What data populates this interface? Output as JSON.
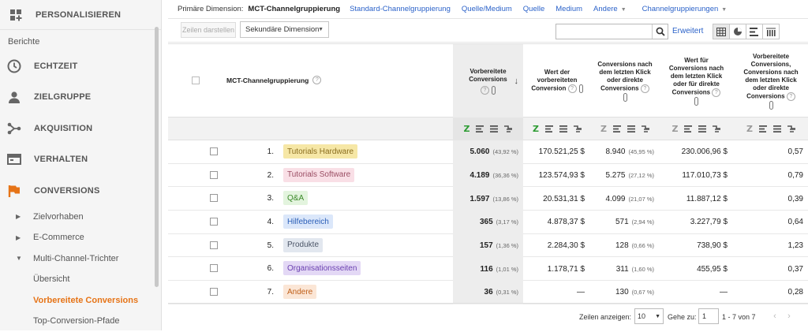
{
  "sidebar": {
    "personalize": "PERSONALISIEREN",
    "section": "Berichte",
    "items": [
      {
        "label": "ECHTZEIT",
        "icon": "clock-icon"
      },
      {
        "label": "ZIELGRUPPE",
        "icon": "person-icon"
      },
      {
        "label": "AKQUISITION",
        "icon": "acquisition-icon"
      },
      {
        "label": "VERHALTEN",
        "icon": "behavior-icon"
      },
      {
        "label": "CONVERSIONS",
        "icon": "flag-icon",
        "color": "#e67417"
      }
    ],
    "sub": [
      "Zielvorhaben",
      "E-Commerce",
      "Multi-Channel-Trichter"
    ],
    "sub2": [
      "Übersicht",
      "Vorbereitete Conversions",
      "Top-Conversion-Pfade"
    ],
    "active": "Vorbereitete Conversions",
    "active_color": "#e67417"
  },
  "dimension": {
    "primary_label": "Primäre Dimension:",
    "current": "MCT-Channelgruppierung",
    "links": [
      "Standard-Channelgruppierung",
      "Quelle/Medium",
      "Quelle",
      "Medium"
    ],
    "other": "Andere",
    "groupings": "Channelgruppierungen",
    "link_color": "#2b62c9"
  },
  "toolbar": {
    "show_rows_btn": "Zeilen darstellen",
    "secondary": "Sekundäre Dimension",
    "search_value": "",
    "advanced": "Erweitert"
  },
  "table": {
    "dim_header": "MCT-Channelgruppierung",
    "columns": [
      {
        "l1": "Vorbereitete",
        "l2": "Conversions"
      },
      {
        "l1": "Wert der",
        "l2": "vorbereiteten",
        "l3": "Conversion"
      },
      {
        "l1": "Conversions nach",
        "l2": "dem letzten Klick",
        "l3": "oder direkte",
        "l4": "Conversions"
      },
      {
        "l1": "Wert für",
        "l2": "Conversions nach",
        "l3": "dem letzten Klick",
        "l4": "oder für direkte",
        "l5": "Conversions"
      },
      {
        "l1": "Vorbereitete",
        "l2": "Conversions,",
        "l3": "Conversions nach",
        "l4": "dem letzten Klick",
        "l5": "oder direkte",
        "l6": "Conversions"
      }
    ],
    "rows": [
      {
        "n": "1.",
        "name": "Tutorials Hardware",
        "bg": "#f6e7a6",
        "fg": "#8a6d1e",
        "ac": "5.060",
        "acp": "(43,92 %)",
        "av": "170.521,25 $",
        "lc": "8.940",
        "lcp": "(45,95 %)",
        "lv": "230.006,96 $",
        "ratio": "0,57"
      },
      {
        "n": "2.",
        "name": "Tutorials Software",
        "bg": "#f9dfe6",
        "fg": "#9a4d63",
        "ac": "4.189",
        "acp": "(36,36 %)",
        "av": "123.574,93 $",
        "lc": "5.275",
        "lcp": "(27,12 %)",
        "lv": "117.010,73 $",
        "ratio": "0,79"
      },
      {
        "n": "3.",
        "name": "Q&A",
        "bg": "#e3f4de",
        "fg": "#3d8a2b",
        "ac": "1.597",
        "acp": "(13,86 %)",
        "av": "20.531,31 $",
        "lc": "4.099",
        "lcp": "(21,07 %)",
        "lv": "11.887,12 $",
        "ratio": "0,39"
      },
      {
        "n": "4.",
        "name": "Hilfebereich",
        "bg": "#dbe7fa",
        "fg": "#2b5fb8",
        "ac": "365",
        "acp": "(3,17 %)",
        "av": "4.878,37 $",
        "lc": "571",
        "lcp": "(2,94 %)",
        "lv": "3.227,79 $",
        "ratio": "0,64"
      },
      {
        "n": "5.",
        "name": "Produkte",
        "bg": "#e2e7ef",
        "fg": "#4b5567",
        "ac": "157",
        "acp": "(1,36 %)",
        "av": "2.284,30 $",
        "lc": "128",
        "lcp": "(0,66 %)",
        "lv": "738,90 $",
        "ratio": "1,23"
      },
      {
        "n": "6.",
        "name": "Organisationsseiten",
        "bg": "#e3d8f5",
        "fg": "#6a3fb0",
        "ac": "116",
        "acp": "(1,01 %)",
        "av": "1.178,71 $",
        "lc": "311",
        "lcp": "(1,60 %)",
        "lv": "455,95 $",
        "ratio": "0,37"
      },
      {
        "n": "7.",
        "name": "Andere",
        "bg": "#fbe6d6",
        "fg": "#c0601a",
        "ac": "36",
        "acp": "(0,31 %)",
        "av": "—",
        "lc": "130",
        "lcp": "(0,67 %)",
        "lv": "—",
        "ratio": "0,28"
      }
    ]
  },
  "footer": {
    "show_rows": "Zeilen anzeigen:",
    "rows_value": "10",
    "goto": "Gehe zu:",
    "goto_value": "1",
    "range": "1 - 7 von 7"
  }
}
